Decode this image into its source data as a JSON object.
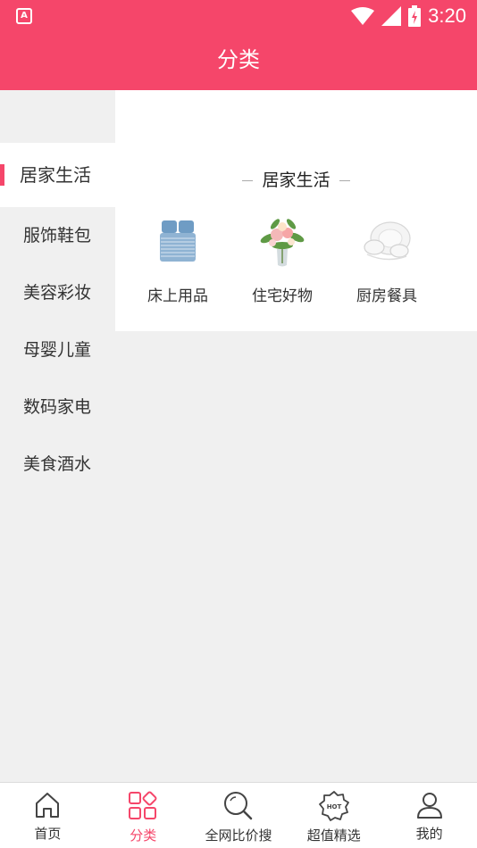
{
  "status": {
    "time": "3:20",
    "app_badge": "A"
  },
  "header": {
    "title": "分类"
  },
  "sidebar": {
    "items": [
      {
        "label": "居家生活",
        "active": true
      },
      {
        "label": "服饰鞋包"
      },
      {
        "label": "美容彩妆"
      },
      {
        "label": "母婴儿童"
      },
      {
        "label": "数码家电"
      },
      {
        "label": "美食酒水"
      }
    ]
  },
  "content": {
    "section_title": "居家生活",
    "items": [
      {
        "label": "床上用品",
        "icon": "bedding-image"
      },
      {
        "label": "住宅好物",
        "icon": "flower-vase-image"
      },
      {
        "label": "厨房餐具",
        "icon": "tableware-image"
      }
    ]
  },
  "tabbar": {
    "tabs": [
      {
        "label": "首页",
        "icon": "home-icon"
      },
      {
        "label": "分类",
        "icon": "category-icon",
        "active": true
      },
      {
        "label": "全网比价搜",
        "icon": "search-icon"
      },
      {
        "label": "超值精选",
        "icon": "hot-badge-icon",
        "badge": "HOT"
      },
      {
        "label": "我的",
        "icon": "user-icon"
      }
    ]
  },
  "colors": {
    "accent": "#f5466a",
    "background": "#f0f0f0"
  }
}
